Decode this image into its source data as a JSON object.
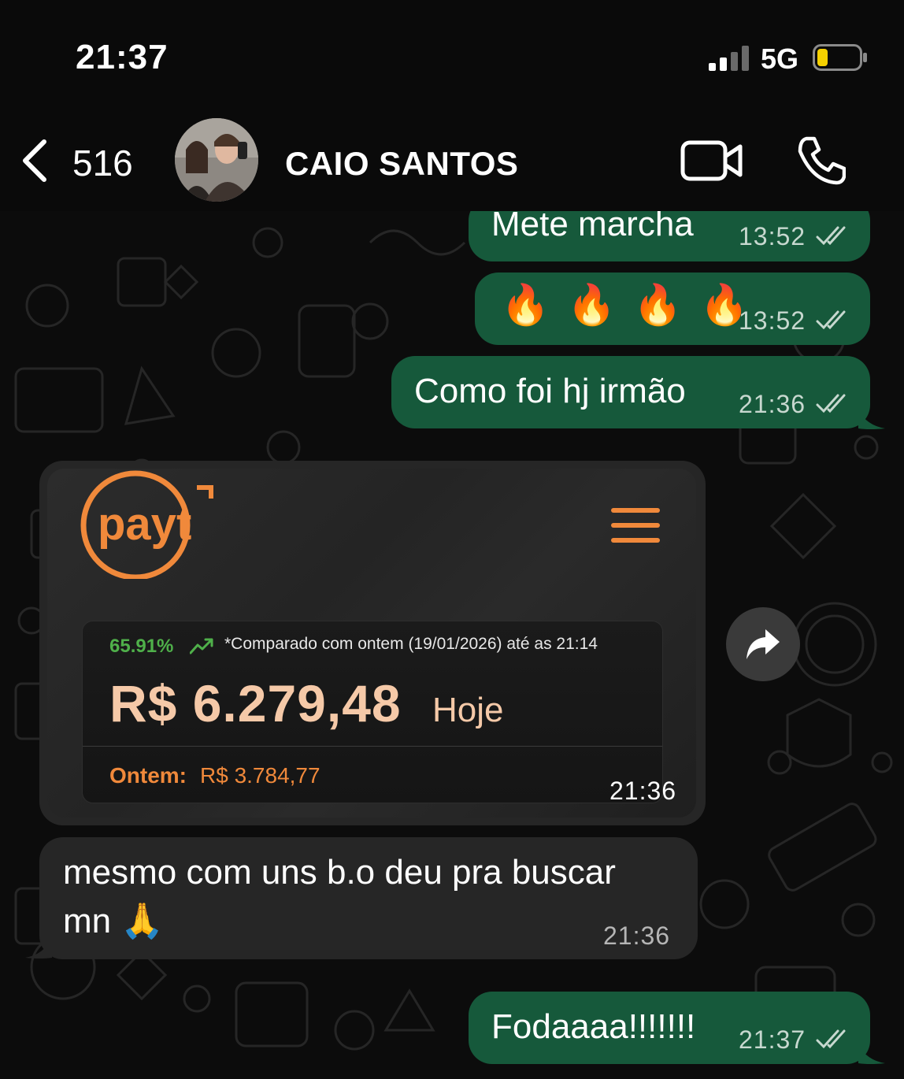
{
  "status_bar": {
    "time": "21:37",
    "network": "5G",
    "battery_level": 0.25,
    "battery_color": "#f5d000"
  },
  "header": {
    "back_icon": "chevron-left-icon",
    "unread_count": "516",
    "contact_name": "CAIO SANTOS",
    "video_icon": "video-camera-icon",
    "call_icon": "phone-icon"
  },
  "messages": [
    {
      "direction": "out",
      "text": "Mete marcha",
      "time": "13:52",
      "status": "read"
    },
    {
      "direction": "out",
      "text": "🔥 🔥 🔥 🔥",
      "time": "13:52",
      "status": "read"
    },
    {
      "direction": "out",
      "text": "Como foi hj irmão",
      "time": "21:36",
      "status": "read"
    },
    {
      "direction": "in",
      "type": "image",
      "time": "21:36",
      "card": {
        "brand": "payt",
        "growth": "65.91%",
        "comparison_note": "*Comparado com ontem (19/01/2026) até as 21:14",
        "amount": "R$ 6.279,48",
        "amount_label": "Hoje",
        "yesterday_label": "Ontem:",
        "yesterday_value": "R$ 3.784,77",
        "accent_color": "#f0893b"
      }
    },
    {
      "direction": "in",
      "text_line1": "mesmo com uns b.o deu pra buscar",
      "text_line2": "mn 🙏",
      "time": "21:36"
    },
    {
      "direction": "out",
      "text": "Fodaaaa!!!!!!!",
      "time": "21:37",
      "status": "read"
    }
  ],
  "colors": {
    "outgoing_bubble": "#16593b",
    "incoming_bubble": "#262626",
    "background": "#0c0c0c"
  }
}
